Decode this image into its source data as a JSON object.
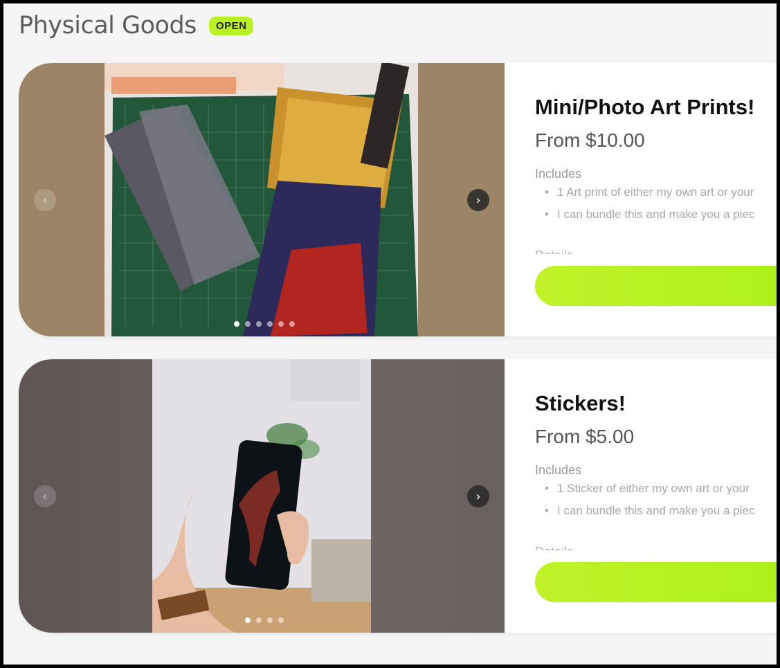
{
  "section": {
    "title": "Physical Goods",
    "badge": "OPEN"
  },
  "products": [
    {
      "title": "Mini/Photo Art Prints!",
      "price": "From $10.00",
      "includes_label": "Includes",
      "includes": [
        "1 Art print of either my own art or your",
        "I can bundle this and make you a piec"
      ],
      "details_label": "Details",
      "carousel_dots": 6,
      "active_dot": 0
    },
    {
      "title": "Stickers!",
      "price": "From $5.00",
      "includes_label": "Includes",
      "includes": [
        "1 Sticker of either my own art or your",
        "I can bundle this and make you a piec"
      ],
      "details_label": "Details",
      "carousel_dots": 4,
      "active_dot": 0
    }
  ],
  "icons": {
    "prev": "chevron-left-icon",
    "next": "chevron-right-icon"
  },
  "colors": {
    "accent": "#b9f224",
    "background": "#f5f5f5"
  }
}
